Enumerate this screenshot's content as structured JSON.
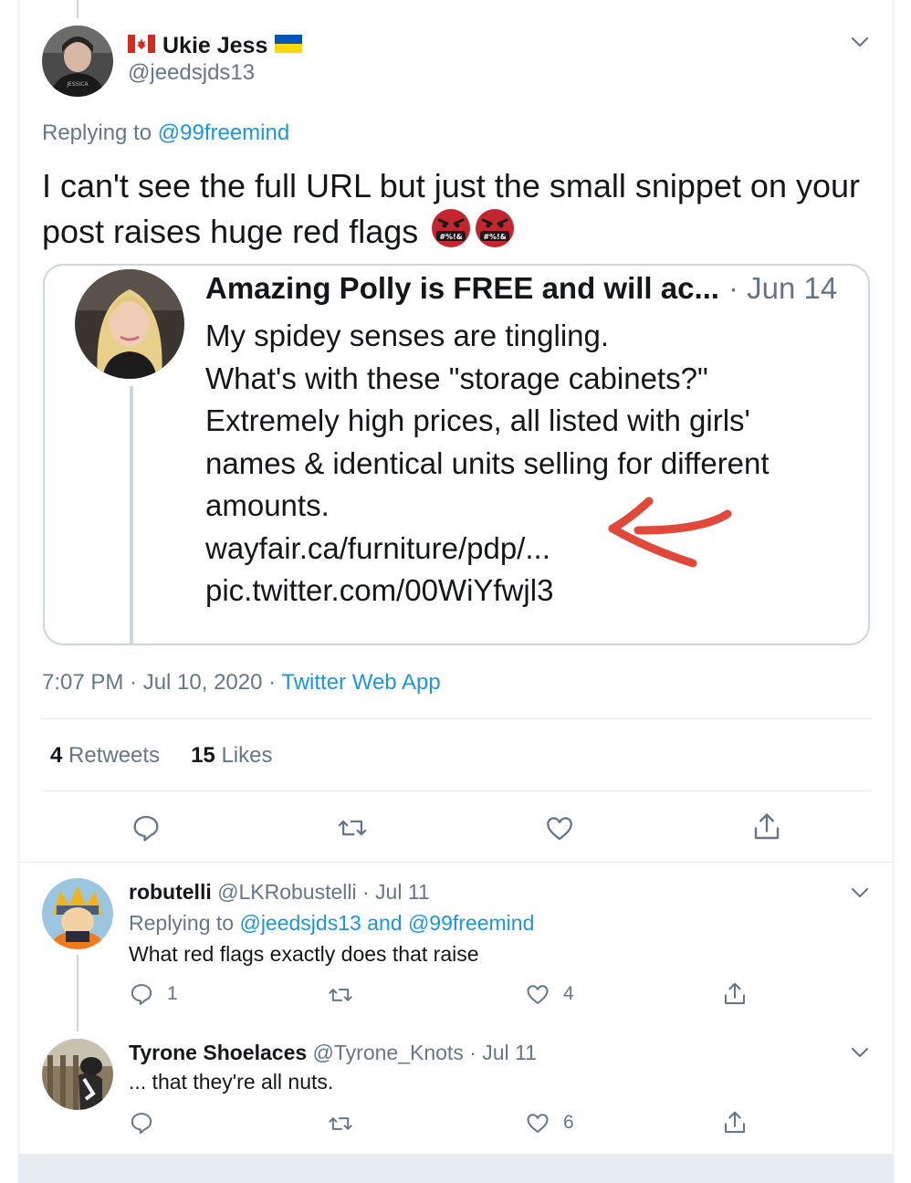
{
  "main_tweet": {
    "display_name": "Ukie Jess",
    "handle": "@jeedsjds13",
    "replying_prefix": "Replying to",
    "replying_to": "@99freemind",
    "text": "I can't see the full URL but just the small snippet on your post raises huge red flags",
    "emoji_label": "#%!&",
    "timestamp": "7:07 PM · Jul 10, 2020 · ",
    "source": "Twitter Web App",
    "retweets_count": "4",
    "retweets_label": "Retweets",
    "likes_count": "15",
    "likes_label": "Likes"
  },
  "quoted_tweet": {
    "name": "Amazing Polly is FREE and will ac...",
    "date": "· Jun 14",
    "text": "My spidey senses are tingling.\nWhat's with these \"storage cabinets?\"\nExtremely high prices, all listed with girls' names & identical units selling for different amounts.\nwayfair.ca/furniture/pdp/...\npic.twitter.com/00WiYfwjl3"
  },
  "replies": [
    {
      "name": "robutelli",
      "handle_date": "@LKRobustelli · Jul 11",
      "replying_prefix": "Replying to",
      "replying_to": "@jeedsjds13 and @99freemind",
      "text": "What red flags exactly does that raise",
      "reply_count": "1",
      "retweet_count": "",
      "like_count": "4"
    },
    {
      "name": "Tyrone Shoelaces",
      "handle_date": "@Tyrone_Knots · Jul 11",
      "text": "... that they're all nuts.",
      "reply_count": "",
      "retweet_count": "",
      "like_count": "6"
    }
  ],
  "colors": {
    "link": "#1b95e0",
    "secondary_text": "#657786",
    "primary_text": "#14171a",
    "border": "#e6ecf0",
    "arrow": "#e0483a",
    "emoji": "#c4262e"
  },
  "icons": [
    "canada-flag-icon",
    "ukraine-flag-icon",
    "chevron-down-icon",
    "reply-icon",
    "retweet-icon",
    "like-icon",
    "share-icon",
    "angry-emoji-icon"
  ]
}
